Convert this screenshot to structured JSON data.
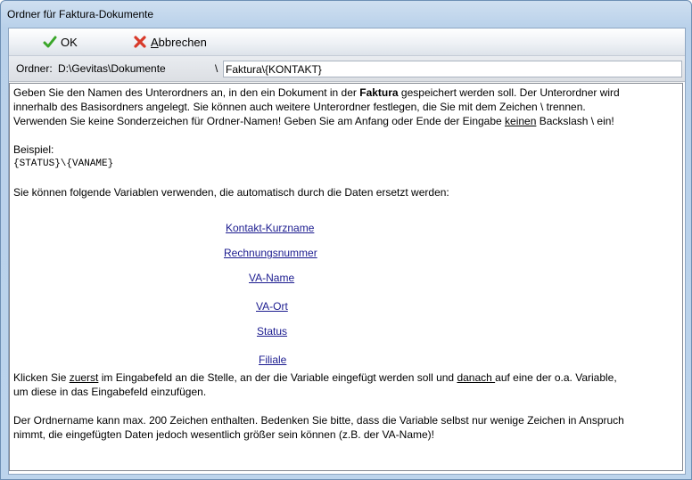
{
  "window": {
    "title": "Ordner für Faktura-Dokumente"
  },
  "toolbar": {
    "ok_label": "OK",
    "cancel_label_first": "A",
    "cancel_label_rest": "bbrechen"
  },
  "pathbar": {
    "label": "Ordner:",
    "base_path": "D:\\Gevitas\\Dokumente",
    "separator": "\\",
    "input_value": "Faktura\\{KONTAKT}"
  },
  "content": {
    "p1_a": "Geben Sie den Namen des Unterordners an, in den ein Dokument in der ",
    "p1_bold": "Faktura",
    "p1_b": " gespeichert werden soll. Der Unterordner wird",
    "p1_line2": "innerhalb des Basisordners angelegt. Sie können auch weitere Unterordner festlegen, die Sie mit dem Zeichen \\ trennen.",
    "p1_line3_a": "Verwenden Sie keine Sonderzeichen für Ordner-Namen! Geben Sie am Anfang oder Ende der Eingabe ",
    "p1_line3_u": "keinen",
    "p1_line3_b": " Backslash \\ ein!",
    "example_label": "Beispiel:",
    "example_code": "{STATUS}\\{VANAME}",
    "vars_intro": "Sie können folgende Variablen verwenden, die automatisch durch die Daten ersetzt werden:",
    "variables": [
      "Kontakt-Kurzname",
      "Rechnungsnummer",
      "VA-Name",
      "VA-Ort",
      "Status",
      "Filiale"
    ],
    "p3_a": "Klicken Sie ",
    "p3_u1": "zuerst",
    "p3_b": " im Eingabefeld an die Stelle, an der die Variable eingefügt werden soll und ",
    "p3_u2": "danach ",
    "p3_c": "auf eine der o.a. Variable,",
    "p3_line2": "um diese in das Eingabefeld einzufügen.",
    "p4_line1": "Der Ordnername kann max. 200 Zeichen enthalten. Bedenken Sie bitte, dass die Variable selbst nur wenige Zeichen in Anspruch",
    "p4_line2": "nimmt, die eingefügten Daten jedoch wesentlich größer sein können (z.B. der VA-Name)!"
  },
  "icons": {
    "ok": "checkmark-icon",
    "cancel": "red-x-icon"
  },
  "colors": {
    "link": "#1b1b8f",
    "ok_green": "#3aa629",
    "cancel_red": "#d83a2a"
  }
}
